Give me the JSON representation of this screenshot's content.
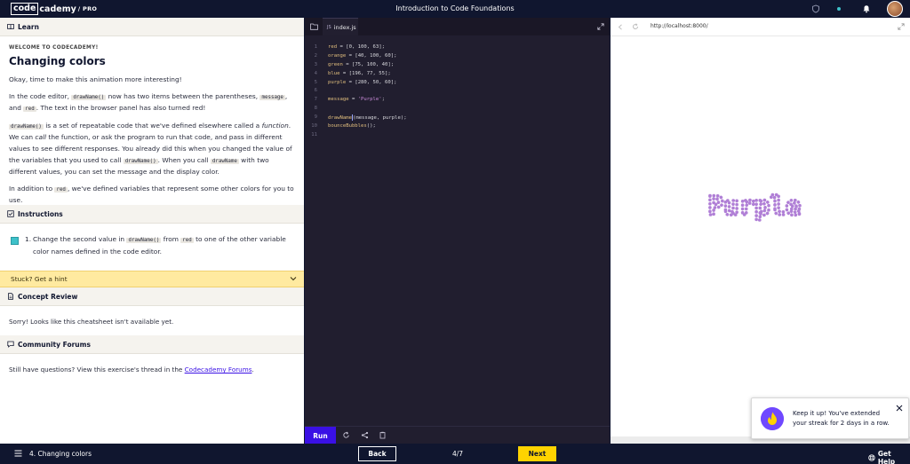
{
  "topbar": {
    "logo_box": "code",
    "logo_rest": "cademy",
    "logo_pro": "/ PRO",
    "course_title": "Introduction to Code Foundations"
  },
  "learn": {
    "header": "Learn",
    "overline": "WELCOME TO CODECADEMY!",
    "title": "Changing colors",
    "p1": "Okay, time to make this animation more interesting!",
    "p2_a": "In the code editor, ",
    "p2_code1": "drawName()",
    "p2_b": " now has two items between the parentheses, ",
    "p2_code2": "message",
    "p2_c": ", and ",
    "p2_code3": "red",
    "p2_d": ". The text in the browser panel has also turned red!",
    "p3_code1": "drawName()",
    "p3_a": " is a set of repeatable code that we've defined elsewhere called a ",
    "p3_em1": "function",
    "p3_b": ". We can ",
    "p3_em2": "call",
    "p3_c": " the function, or ask the program to run that code, and pass in different values to see different responses. You already did this when you changed the value of the variables that you used to call ",
    "p3_code2": "drawName()",
    "p3_d": ". When you call ",
    "p3_code3": "drawName",
    "p3_e": " with two different values, you can set the message and the display color.",
    "p4_a": "In addition to ",
    "p4_code": "red",
    "p4_b": ", we've defined variables that represent some other colors for you to use."
  },
  "instructions": {
    "header": "Instructions",
    "num": "1.",
    "t_a": "Change the second value in ",
    "t_code1": "drawName()",
    "t_b": " from ",
    "t_code2": "red",
    "t_c": " to one of the other variable color names defined in the code editor."
  },
  "hint": {
    "label": "Stuck? Get a hint"
  },
  "concept": {
    "header": "Concept Review",
    "body": "Sorry! Looks like this cheatsheet isn't available yet."
  },
  "forums": {
    "header": "Community Forums",
    "body_a": "Still have questions? View this exercise's thread in the ",
    "link": "Codecademy Forums",
    "body_b": "."
  },
  "editor": {
    "file_icon_label": "JS",
    "file_name": "index.js",
    "run_label": "Run",
    "line_numbers": [
      "1",
      "2",
      "3",
      "4",
      "5",
      "6",
      "7",
      "8",
      "9",
      "10",
      "11"
    ],
    "code": {
      "l1_var": "red",
      "l1_rest": " = [0, 100, 63];",
      "l2_var": "orange",
      "l2_rest": " = [40, 100, 60];",
      "l3_var": "green",
      "l3_rest": " = [75, 100, 40];",
      "l4_var": "blue",
      "l4_rest": " = [196, 77, 55];",
      "l5_var": "purple",
      "l5_rest": " = [280, 50, 60];",
      "l7_var": "message",
      "l7_eq": " = ",
      "l7_str": "'Purple'",
      "l7_end": ";",
      "l9_fn": "drawName",
      "l9_args": "(message, purple",
      "l9_end": ");",
      "l10_fn": "bounceBubbles",
      "l10_end": "();"
    }
  },
  "browser": {
    "url": "http://localhost:8000/",
    "canvas_word": "Purple",
    "bubble_color": "#b07fd6"
  },
  "toast": {
    "text": "Keep it up! You've extended your streak for 2 days in a row."
  },
  "bottombar": {
    "lesson": "4. Changing colors",
    "back": "Back",
    "progress": "4/7",
    "next": "Next",
    "help": "Get Help"
  },
  "colors": {
    "navy": "#10162f",
    "run": "#3a10e5",
    "next": "#ffd300",
    "hint": "#ffeaa0",
    "checkbox": "#3ec1c9"
  }
}
